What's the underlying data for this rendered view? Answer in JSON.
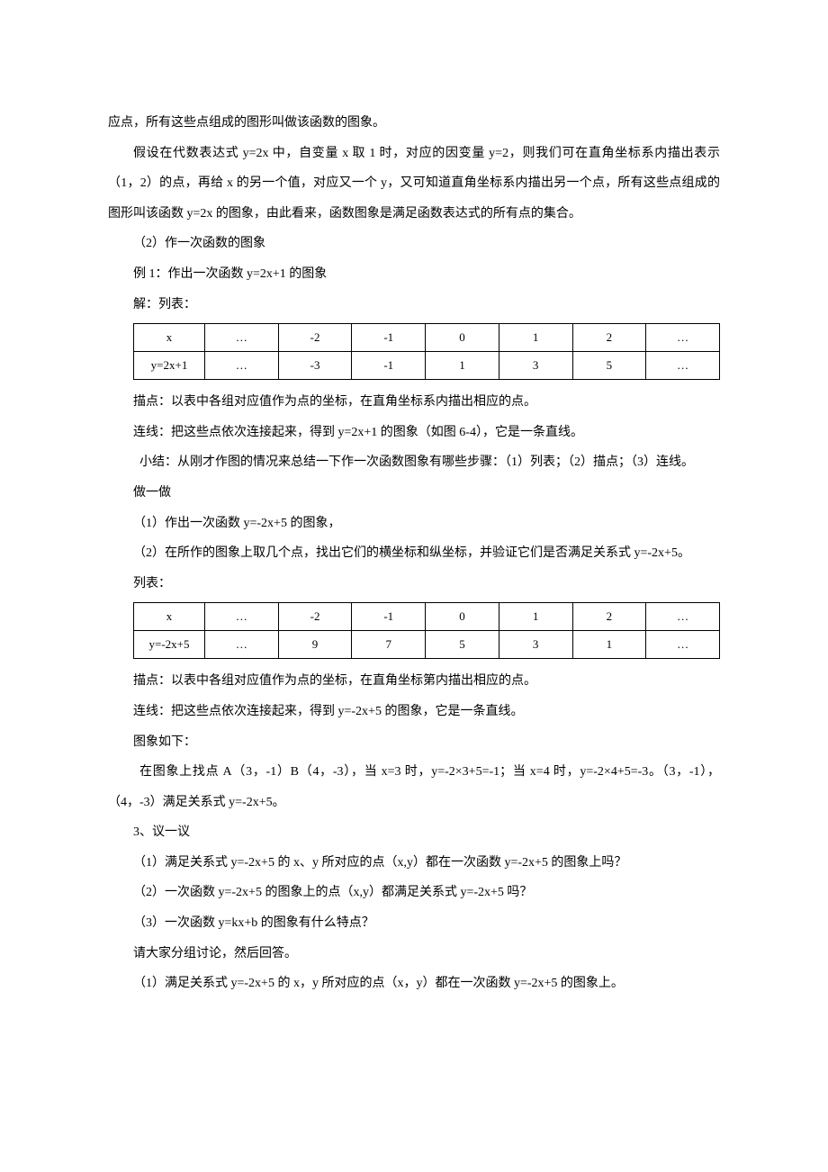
{
  "p1": "应点，所有这些点组成的图形叫做该函数的图象。",
  "p2": "假设在代数表达式 y=2x 中，自变量 x 取 1 时，对应的因变量 y=2，则我们可在直角坐标系内描出表示（1，2）的点，再给 x 的另一个值，对应又一个 y，又可知道直角坐标系内描出另一个点，所有这些点组成的图形叫该函数 y=2x 的图象，由此看来，函数图象是满足函数表达式的所有点的集合。",
  "p3": "（2）作一次函数的图象",
  "p4": "例 1：作出一次函数 y=2x+1 的图象",
  "p5": "解：列表：",
  "table1": {
    "row1": [
      "x",
      "…",
      "-2",
      "-1",
      "0",
      "1",
      "2",
      "…"
    ],
    "row2": [
      "y=2x+1",
      "…",
      "-3",
      "-1",
      "1",
      "3",
      "5",
      "…"
    ]
  },
  "p6": "描点：以表中各组对应值作为点的坐标，在直角坐标系内描出相应的点。",
  "p7": "连线：把这些点依次连接起来，得到 y=2x+1 的图象（如图 6-4），它是一条直线。",
  "p8": "小结：从刚才作图的情况来总结一下作一次函数图象有哪些步骤：（1）列表；（2）描点；（3）连线。",
  "p9": "做一做",
  "p10": "（1）作出一次函数 y=-2x+5 的图象，",
  "p11": "（2）在所作的图象上取几个点，找出它们的横坐标和纵坐标，并验证它们是否满足关系式 y=-2x+5。",
  "p12": "列表：",
  "table2": {
    "row1": [
      "x",
      "…",
      "-2",
      "-1",
      "0",
      "1",
      "2",
      "…"
    ],
    "row2": [
      "y=-2x+5",
      "…",
      "9",
      "7",
      "5",
      "3",
      "1",
      "…"
    ]
  },
  "p13": "描点：以表中各组对应值作为点的坐标，在直角坐标第内描出相应的点。",
  "p14": "连线：把这些点依次连接起来，得到 y=-2x+5 的图象，它是一条直线。",
  "p15": "图象如下：",
  "p16": "在图象上找点 A（3，-1）B（4，-3），当 x=3 时，y=-2×3+5=-1；当 x=4 时，y=-2×4+5=-3。（3，-1），（4，-3）满足关系式 y=-2x+5。",
  "p17": "3、议一议",
  "p18": "（1）满足关系式 y=-2x+5 的 x、y 所对应的点（x,y）都在一次函数 y=-2x+5 的图象上吗？",
  "p19": "（2）一次函数 y=-2x+5 的图象上的点（x,y）都满足关系式 y=-2x+5 吗？",
  "p20": "（3）一次函数 y=kx+b 的图象有什么特点？",
  "p21": "请大家分组讨论，然后回答。",
  "p22": "（1）满足关系式 y=-2x+5 的 x，y 所对应的点（x，y）都在一次函数 y=-2x+5 的图象上。"
}
